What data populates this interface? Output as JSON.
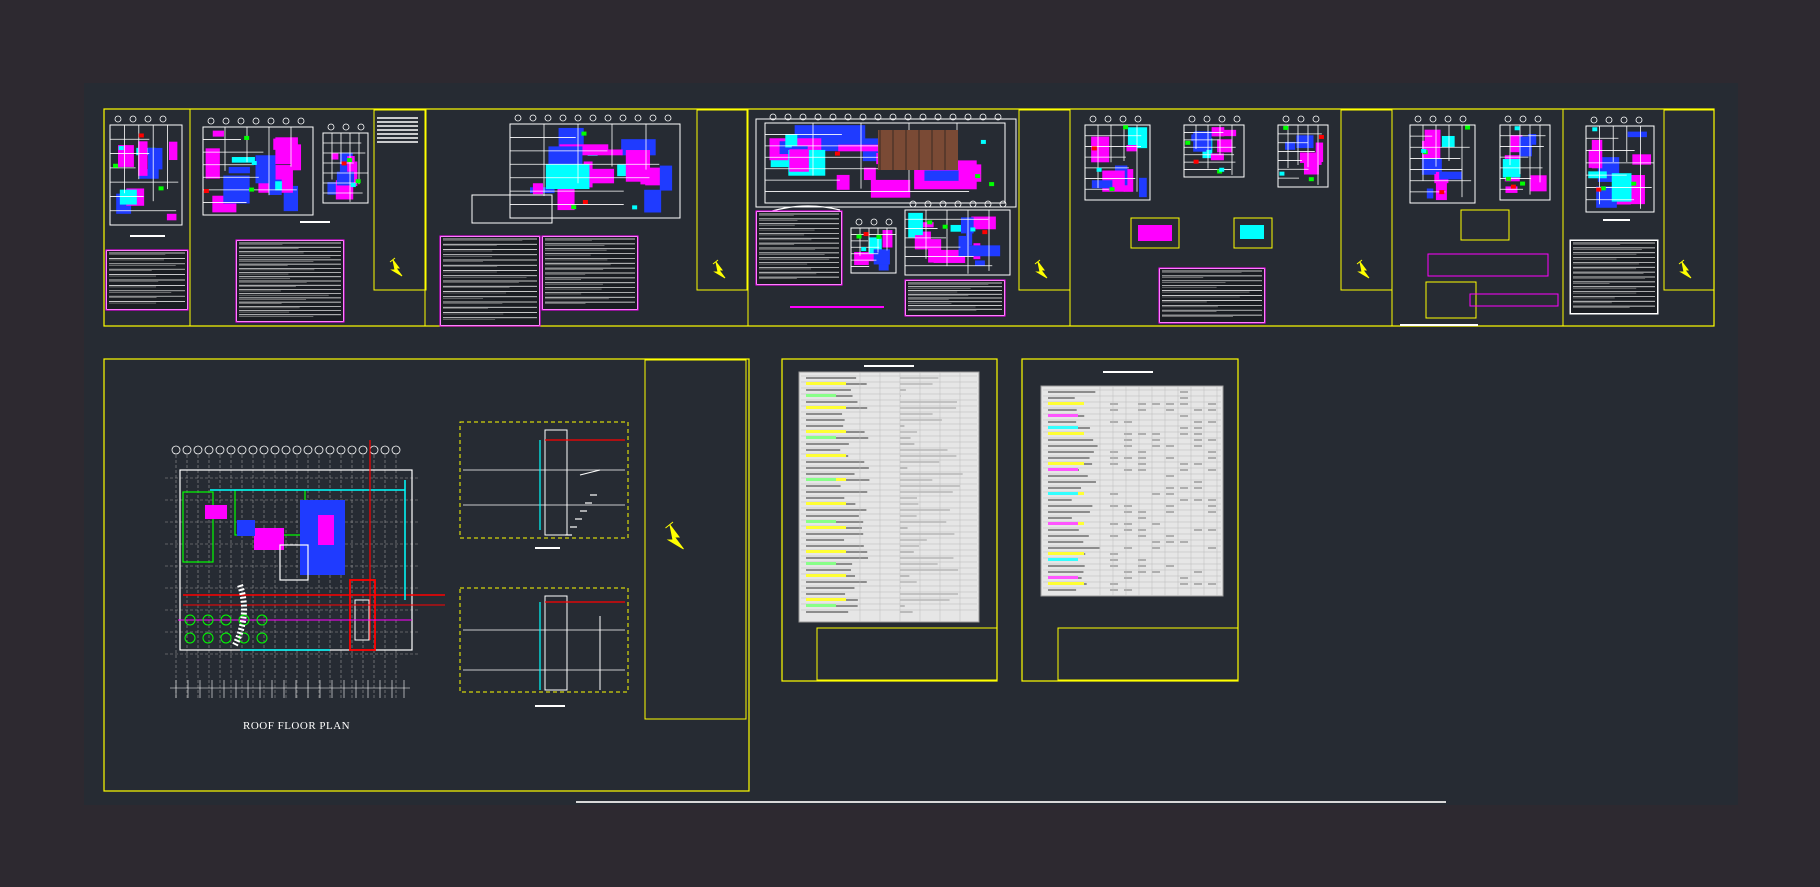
{
  "drawing": {
    "title": "ROOF FLOOR PLAN",
    "colors": {
      "page_bg": "#2d2930",
      "model_bg": "#262b33",
      "frame": "#ffff00",
      "wall": "#ffffff",
      "magenta": "#ff00ff",
      "blue": "#1f3bff",
      "cyan": "#00ffff",
      "green": "#00ff00",
      "red": "#ff0000",
      "gray": "#9a9a9a"
    },
    "icons": [
      "north-arrow-icon"
    ]
  }
}
